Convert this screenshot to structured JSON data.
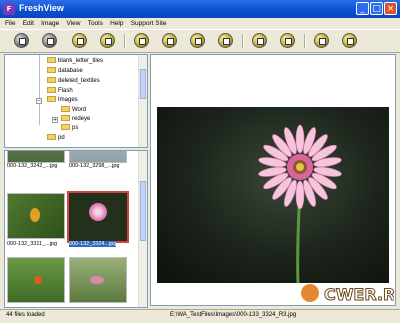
{
  "app": {
    "title": "FreshView"
  },
  "menu": [
    "File",
    "Edit",
    "Image",
    "View",
    "Tools",
    "Help",
    "Support Site"
  ],
  "tree": {
    "items": [
      {
        "label": "blank_letter_tiles"
      },
      {
        "label": "database"
      },
      {
        "label": "deleted_textiles"
      },
      {
        "label": "Flash"
      },
      {
        "label": "Images"
      },
      {
        "label": "Word"
      },
      {
        "label": "redeye"
      },
      {
        "label": "ps"
      },
      {
        "label": "pd"
      }
    ]
  },
  "thumbnails": [
    {
      "label": "000-132_3242_...jpg"
    },
    {
      "label": "000-132_3298_...jpg"
    },
    {
      "label": "000-132_3311_...jpg"
    },
    {
      "label": "000-132_3324...jpg"
    }
  ],
  "status": {
    "left": "44 files loaded",
    "path": "E:\\WA_TestFiles\\Images\\000-133_3324_R3.jpg"
  },
  "watermark": {
    "text": "CWER.RU"
  },
  "colors": {
    "accent": "#316ac5",
    "titlebar": "#0a4fd0"
  }
}
